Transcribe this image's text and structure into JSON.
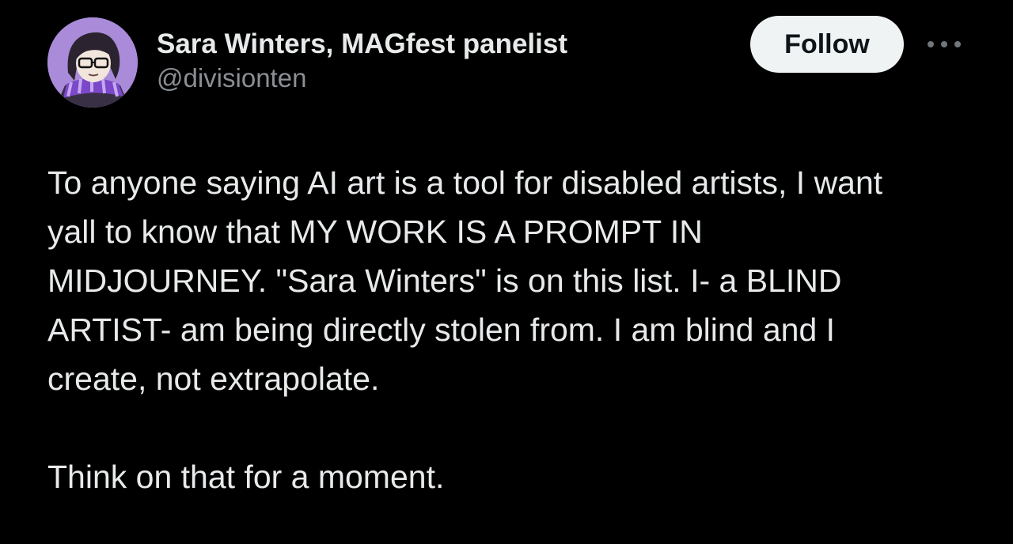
{
  "author": {
    "display_name": "Sara Winters, MAGfest panelist",
    "handle": "@divisionten",
    "avatar_icon": "cartoon-portrait-avatar"
  },
  "actions": {
    "follow_label": "Follow",
    "more_icon": "more-horizontal-icon"
  },
  "tweet": {
    "lines": [
      "To anyone saying AI art is a tool for disabled artists, I want",
      "yall to know that MY WORK IS A PROMPT IN",
      "MIDJOURNEY. \"Sara Winters\" is on this list. I- a BLIND",
      "ARTIST- am being directly stolen from. I am blind and I",
      "create, not extrapolate."
    ],
    "closing": "Think on that for a moment."
  },
  "colors": {
    "background": "#000000",
    "text_primary": "#e7e9ea",
    "text_secondary": "#8b8f94",
    "follow_bg": "#eff3f4",
    "follow_text": "#0f1419",
    "avatar_bg": "#a98bd9"
  }
}
